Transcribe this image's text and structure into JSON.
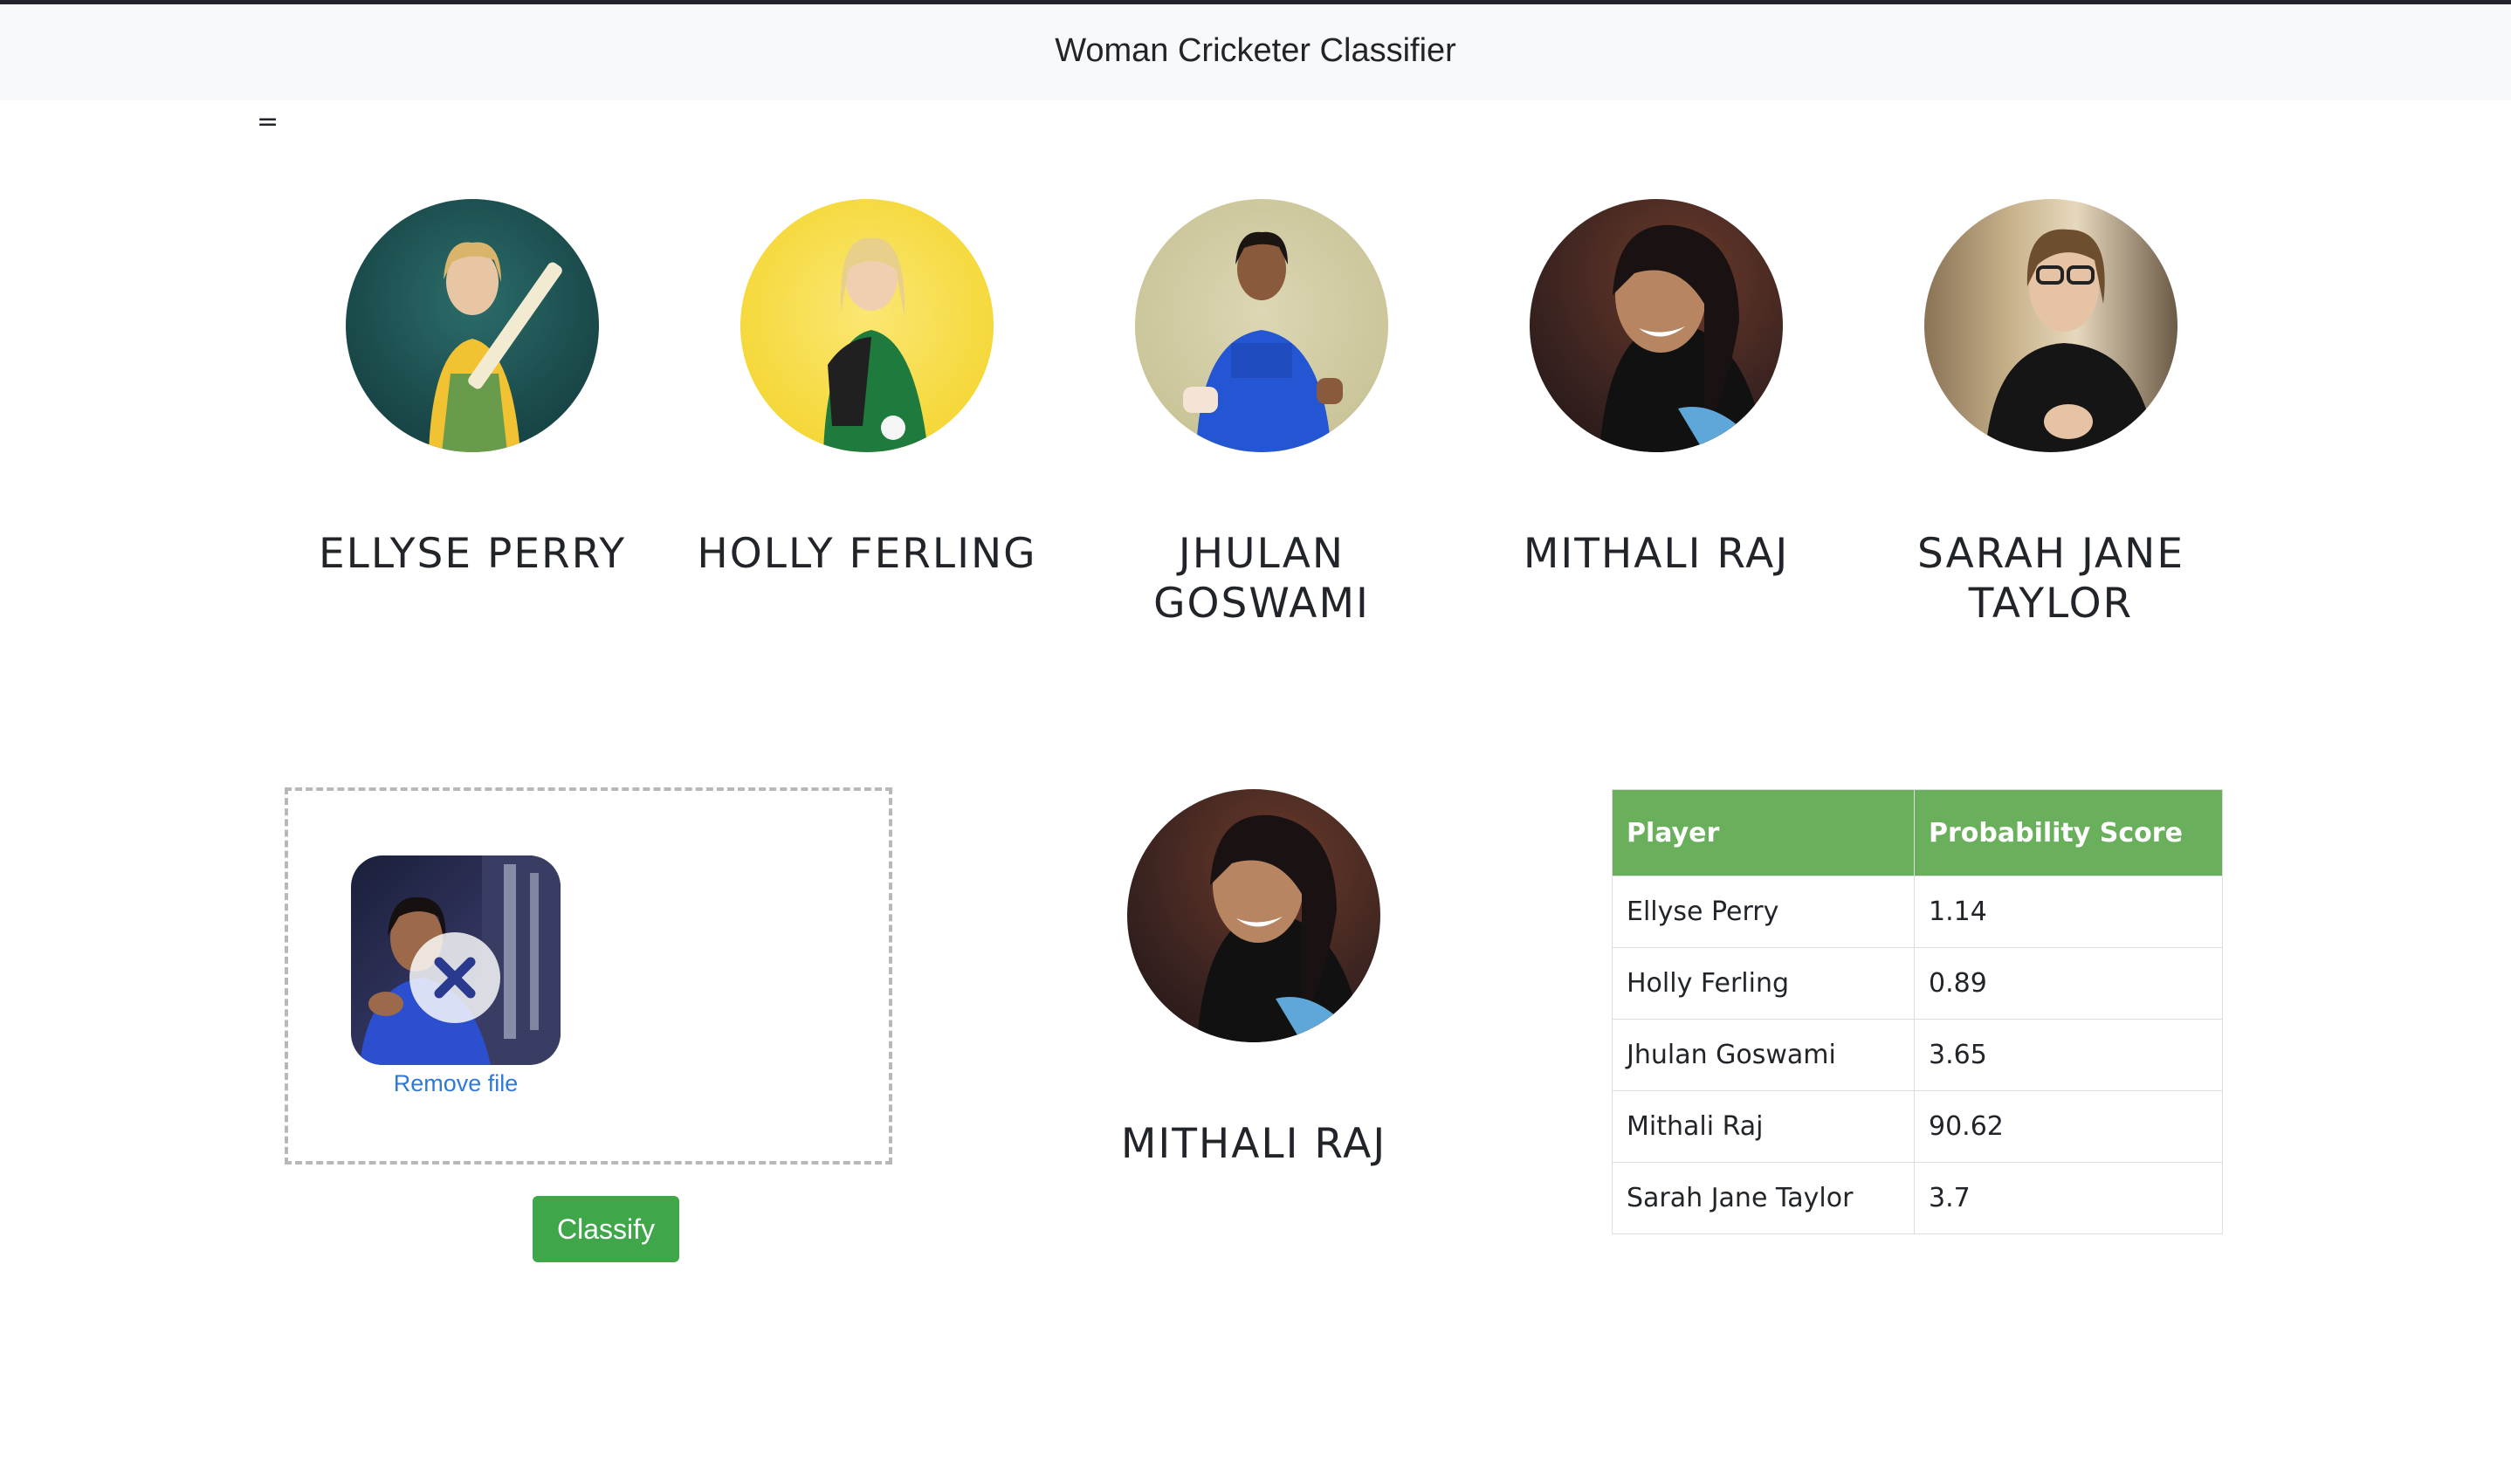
{
  "navbar": {
    "title": "Woman Cricketer Classifier"
  },
  "misc": {
    "equals_text": "="
  },
  "players": [
    {
      "name": "ELLYSE PERRY"
    },
    {
      "name": "HOLLY FERLING"
    },
    {
      "name": "JHULAN GOSWAMI"
    },
    {
      "name": "MITHALI RAJ"
    },
    {
      "name": "SARAH JANE TAYLOR"
    }
  ],
  "upload": {
    "remove_label": "Remove file",
    "classify_label": "Classify"
  },
  "result": {
    "name": "MITHALI RAJ"
  },
  "table": {
    "headers": [
      "Player",
      "Probability Score"
    ],
    "rows": [
      [
        "Ellyse Perry",
        "1.14"
      ],
      [
        "Holly Ferling",
        "0.89"
      ],
      [
        "Jhulan Goswami",
        "3.65"
      ],
      [
        "Mithali Raj",
        "90.62"
      ],
      [
        "Sarah Jane Taylor",
        "3.7"
      ]
    ]
  },
  "colors": {
    "navbar_bg": "#f8f9fa",
    "table_header": "#6aaf5c",
    "classify_button": "#3fa64a",
    "link": "#2f7ad8"
  }
}
